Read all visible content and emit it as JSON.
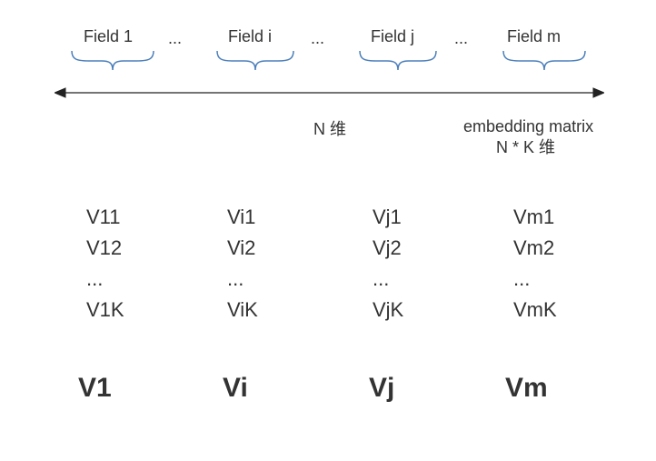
{
  "fields": {
    "labels": [
      "Field 1",
      "Field i",
      "Field j",
      "Field m"
    ],
    "dots": "..."
  },
  "axis": {
    "n_label": "N 维"
  },
  "matrix_label": {
    "line1": "embedding matrix",
    "line2": "N * K 维"
  },
  "columns": [
    {
      "rows": [
        "V11",
        "V12",
        "...",
        "V1K"
      ],
      "vec": "V1"
    },
    {
      "rows": [
        "Vi1",
        "Vi2",
        "...",
        "ViK"
      ],
      "vec": "Vi"
    },
    {
      "rows": [
        "Vj1",
        "Vj2",
        "...",
        "VjK"
      ],
      "vec": "Vj"
    },
    {
      "rows": [
        "Vm1",
        "Vm2",
        "...",
        "VmK"
      ],
      "vec": "Vm"
    }
  ],
  "layout": {
    "col_x": [
      95,
      250,
      410,
      565
    ],
    "brace_x": [
      78,
      238,
      395,
      553
    ],
    "brace_w": [
      92,
      86,
      86,
      92
    ],
    "dots_x": [
      185,
      342,
      500
    ]
  }
}
